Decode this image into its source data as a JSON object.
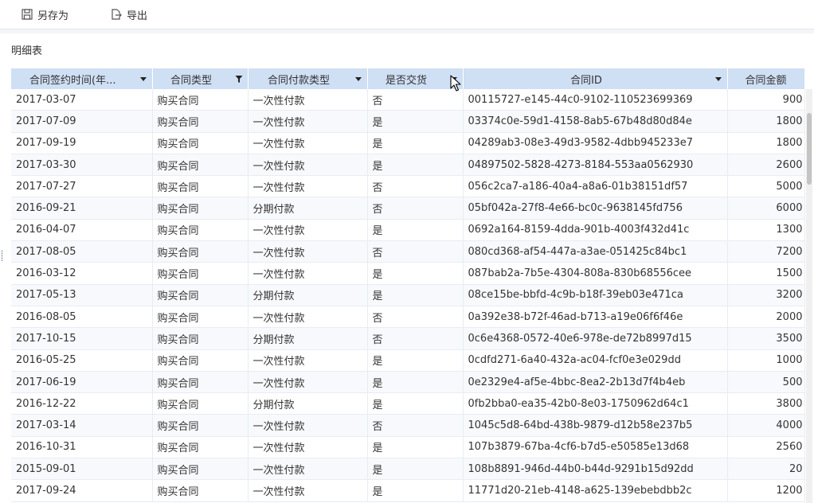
{
  "toolbar": {
    "save_as_label": "另存为",
    "export_label": "导出",
    "save_as_icon": "save-icon",
    "export_icon": "export-icon"
  },
  "report": {
    "title": "明细表"
  },
  "table": {
    "columns": [
      {
        "label": "合同签约时间(年...",
        "icon": "dropdown-arrow-icon"
      },
      {
        "label": "合同类型",
        "icon": "filter-icon"
      },
      {
        "label": "合同付款类型",
        "icon": "dropdown-arrow-icon"
      },
      {
        "label": "是否交货",
        "icon": "dropdown-arrow-icon"
      },
      {
        "label": "合同ID",
        "icon": "dropdown-arrow-icon"
      },
      {
        "label": "合同金额",
        "icon": ""
      }
    ],
    "rows": [
      [
        "2017-03-07",
        "购买合同",
        "一次性付款",
        "否",
        "00115727-e145-44c0-9102-110523699369",
        "900"
      ],
      [
        "2017-07-09",
        "购买合同",
        "一次性付款",
        "是",
        "03374c0e-59d1-4158-8ab5-67b48d80d84e",
        "1800"
      ],
      [
        "2017-09-19",
        "购买合同",
        "一次性付款",
        "是",
        "04289ab3-08e3-49d3-9582-4dbb945233e7",
        "1800"
      ],
      [
        "2017-03-30",
        "购买合同",
        "一次性付款",
        "是",
        "04897502-5828-4273-8184-553aa0562930",
        "2600"
      ],
      [
        "2017-07-27",
        "购买合同",
        "一次性付款",
        "否",
        "056c2ca7-a186-40a4-a8a6-01b38151df57",
        "5000"
      ],
      [
        "2016-09-21",
        "购买合同",
        "分期付款",
        "否",
        "05bf042a-27f8-4e66-bc0c-9638145fd756",
        "6000"
      ],
      [
        "2016-04-07",
        "购买合同",
        "一次性付款",
        "是",
        "0692a164-8159-4dda-901b-4003f432d41c",
        "1300"
      ],
      [
        "2017-08-05",
        "购买合同",
        "一次性付款",
        "否",
        "080cd368-af54-447a-a3ae-051425c84bc1",
        "7200"
      ],
      [
        "2016-03-12",
        "购买合同",
        "一次性付款",
        "是",
        "087bab2a-7b5e-4304-808a-830b68556cee",
        "1500"
      ],
      [
        "2017-05-13",
        "购买合同",
        "分期付款",
        "是",
        "08ce15be-bbfd-4c9b-b18f-39eb03e471ca",
        "3200"
      ],
      [
        "2016-08-05",
        "购买合同",
        "一次性付款",
        "否",
        "0a392e38-b72f-46ad-b713-a19e06f6f46e",
        "2000"
      ],
      [
        "2017-10-15",
        "购买合同",
        "分期付款",
        "否",
        "0c6e4368-0572-40e6-978e-de72b8997d15",
        "3500"
      ],
      [
        "2016-05-25",
        "购买合同",
        "一次性付款",
        "是",
        "0cdfd271-6a40-432a-ac04-fcf0e3e029dd",
        "1000"
      ],
      [
        "2017-06-19",
        "购买合同",
        "一次性付款",
        "是",
        "0e2329e4-af5e-4bbc-8ea2-2b13d7f4b4eb",
        "500"
      ],
      [
        "2016-12-22",
        "购买合同",
        "分期付款",
        "是",
        "0fb2bba0-ea35-42b0-8e03-1750962d64c1",
        "3800"
      ],
      [
        "2017-03-14",
        "购买合同",
        "一次性付款",
        "否",
        "1045c5d8-64bd-438b-9879-d12b58e237b5",
        "4000"
      ],
      [
        "2016-10-31",
        "购买合同",
        "一次性付款",
        "是",
        "107b3879-67ba-4cf6-b7d5-e50585e13d68",
        "2560"
      ],
      [
        "2015-09-01",
        "购买合同",
        "一次性付款",
        "是",
        "108b8891-946d-44b0-b44d-9291b15d92dd",
        "20"
      ],
      [
        "2017-09-24",
        "购买合同",
        "一次性付款",
        "是",
        "11771d20-21eb-4148-a625-139ebebdbb2c",
        "1200"
      ]
    ]
  },
  "colors": {
    "header_bg": "#cfdff4",
    "row_alt_bg": "#f7f9fc",
    "grid_line": "#e8ecf1"
  }
}
